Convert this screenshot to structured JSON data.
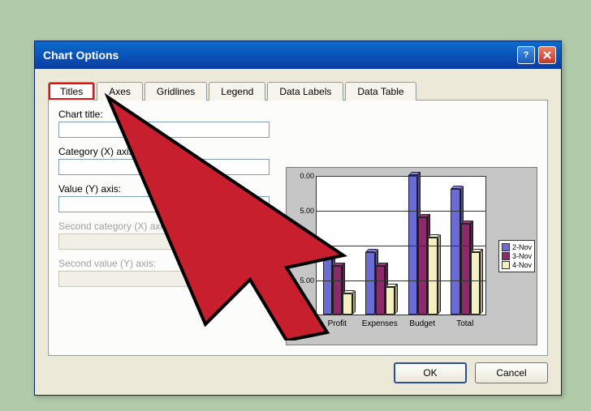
{
  "window": {
    "title": "Chart Options"
  },
  "tabs": {
    "titles": "Titles",
    "axes": "Axes",
    "gridlines": "Gridlines",
    "legend": "Legend",
    "data_labels": "Data Labels",
    "data_table": "Data Table"
  },
  "fields": {
    "chart_title": {
      "label": "Chart title:",
      "value": ""
    },
    "cat_x": {
      "label": "Category (X) axis:",
      "value": ""
    },
    "val_y": {
      "label": "Value (Y) axis:",
      "value": ""
    },
    "second_cat_x": {
      "label": "Second category (X) axis:",
      "value": ""
    },
    "second_val_y": {
      "label": "Second value (Y) axis:",
      "value": ""
    }
  },
  "buttons": {
    "ok": "OK",
    "cancel": "Cancel"
  },
  "chart_data": {
    "type": "bar",
    "categories": [
      "Profit",
      "Expenses",
      "Budget",
      "Total"
    ],
    "series": [
      {
        "name": "2-Nov",
        "color": "#6b6bd6",
        "values": [
          8,
          9,
          20,
          18
        ]
      },
      {
        "name": "3-Nov",
        "color": "#8c2a6b",
        "values": [
          7,
          7,
          14,
          13
        ]
      },
      {
        "name": "4-Nov",
        "color": "#f5f0c0",
        "values": [
          3,
          4,
          11,
          9
        ]
      }
    ],
    "ylabel": "",
    "ylim": [
      0,
      20
    ],
    "yticks_raw": [
      "$-",
      "5.00",
      "0.00",
      "5.00",
      "0.00"
    ],
    "ytick_values": [
      0,
      5,
      10,
      15,
      20
    ],
    "legend_labels": [
      "2-Nov",
      "3-Nov",
      "4-Nov"
    ]
  }
}
